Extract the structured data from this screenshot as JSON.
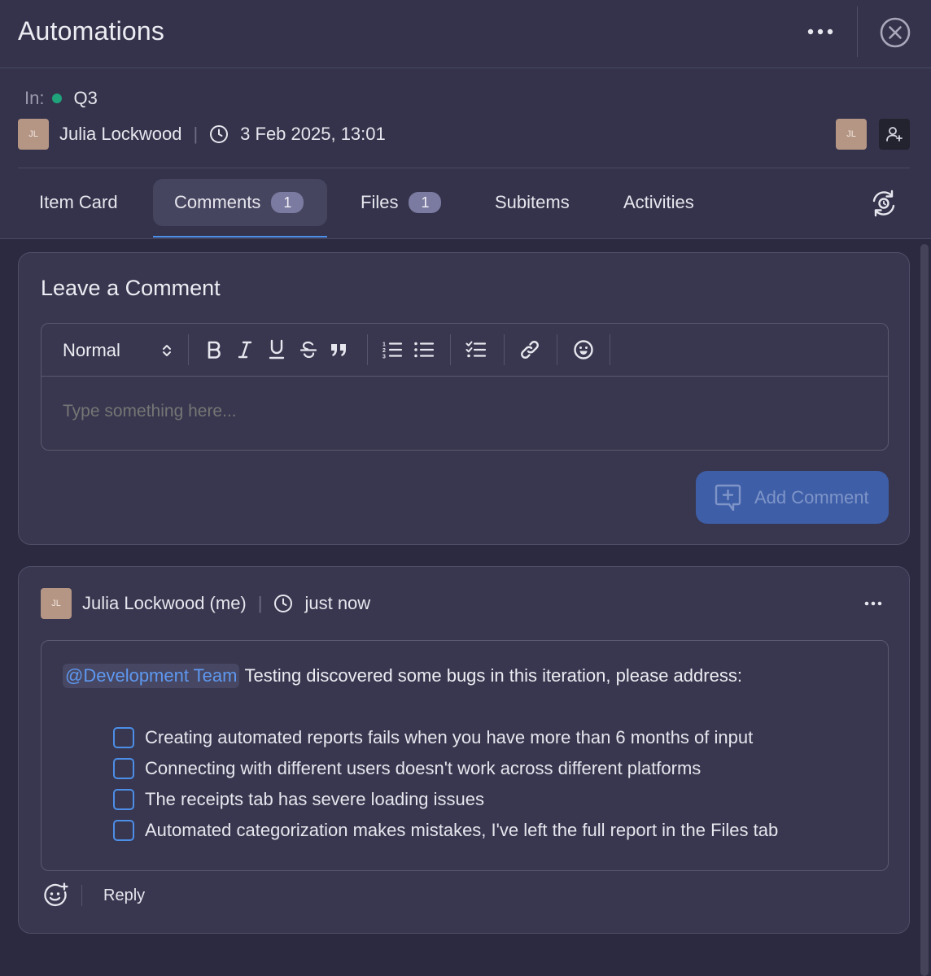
{
  "header": {
    "title": "Automations"
  },
  "meta": {
    "in_label": "In:",
    "group_name": "Q3",
    "group_color": "#1fa37a",
    "author_initials": "JL",
    "author_name": "Julia Lockwood",
    "separator": "|",
    "date": "3 Feb 2025, 13:01",
    "assignee_initials": "JL"
  },
  "tabs": [
    {
      "label": "Item Card"
    },
    {
      "label": "Comments",
      "badge": "1"
    },
    {
      "label": "Files",
      "badge": "1"
    },
    {
      "label": "Subitems"
    },
    {
      "label": "Activities"
    }
  ],
  "active_tab": "Comments",
  "form": {
    "heading": "Leave a Comment",
    "text_style": "Normal",
    "placeholder": "Type something here...",
    "submit_label": "Add Comment"
  },
  "comment": {
    "author_initials": "JL",
    "author": "Julia Lockwood (me)",
    "separator": "|",
    "time": "just now",
    "mention": "@Development Team",
    "text": "Testing discovered some bugs in this iteration, please address:",
    "tasks": [
      {
        "text": "Creating automated reports fails when you have more than 6 months of input",
        "checked": false
      },
      {
        "text": "Connecting with different users doesn't work across different platforms",
        "checked": false
      },
      {
        "text": "The receipts tab has severe loading issues",
        "checked": false
      },
      {
        "text": "Automated categorization makes mistakes, I've left the full report in the Files tab",
        "checked": false
      }
    ],
    "reply_label": "Reply"
  },
  "colors": {
    "accent": "#4c8ee8",
    "background": "#2b2a40",
    "panel": "#34334b",
    "card": "#38374f",
    "button": "#3e5ea8"
  },
  "icons": [
    "more-horizontal-icon",
    "close-circle-icon",
    "clock-icon",
    "add-user-icon",
    "refresh-icon",
    "select-arrows-icon",
    "bold-icon",
    "italic-icon",
    "underline-icon",
    "strikethrough-icon",
    "quote-icon",
    "ordered-list-icon",
    "bullet-list-icon",
    "checklist-icon",
    "link-icon",
    "emoji-icon",
    "add-comment-icon",
    "add-reaction-icon"
  ]
}
